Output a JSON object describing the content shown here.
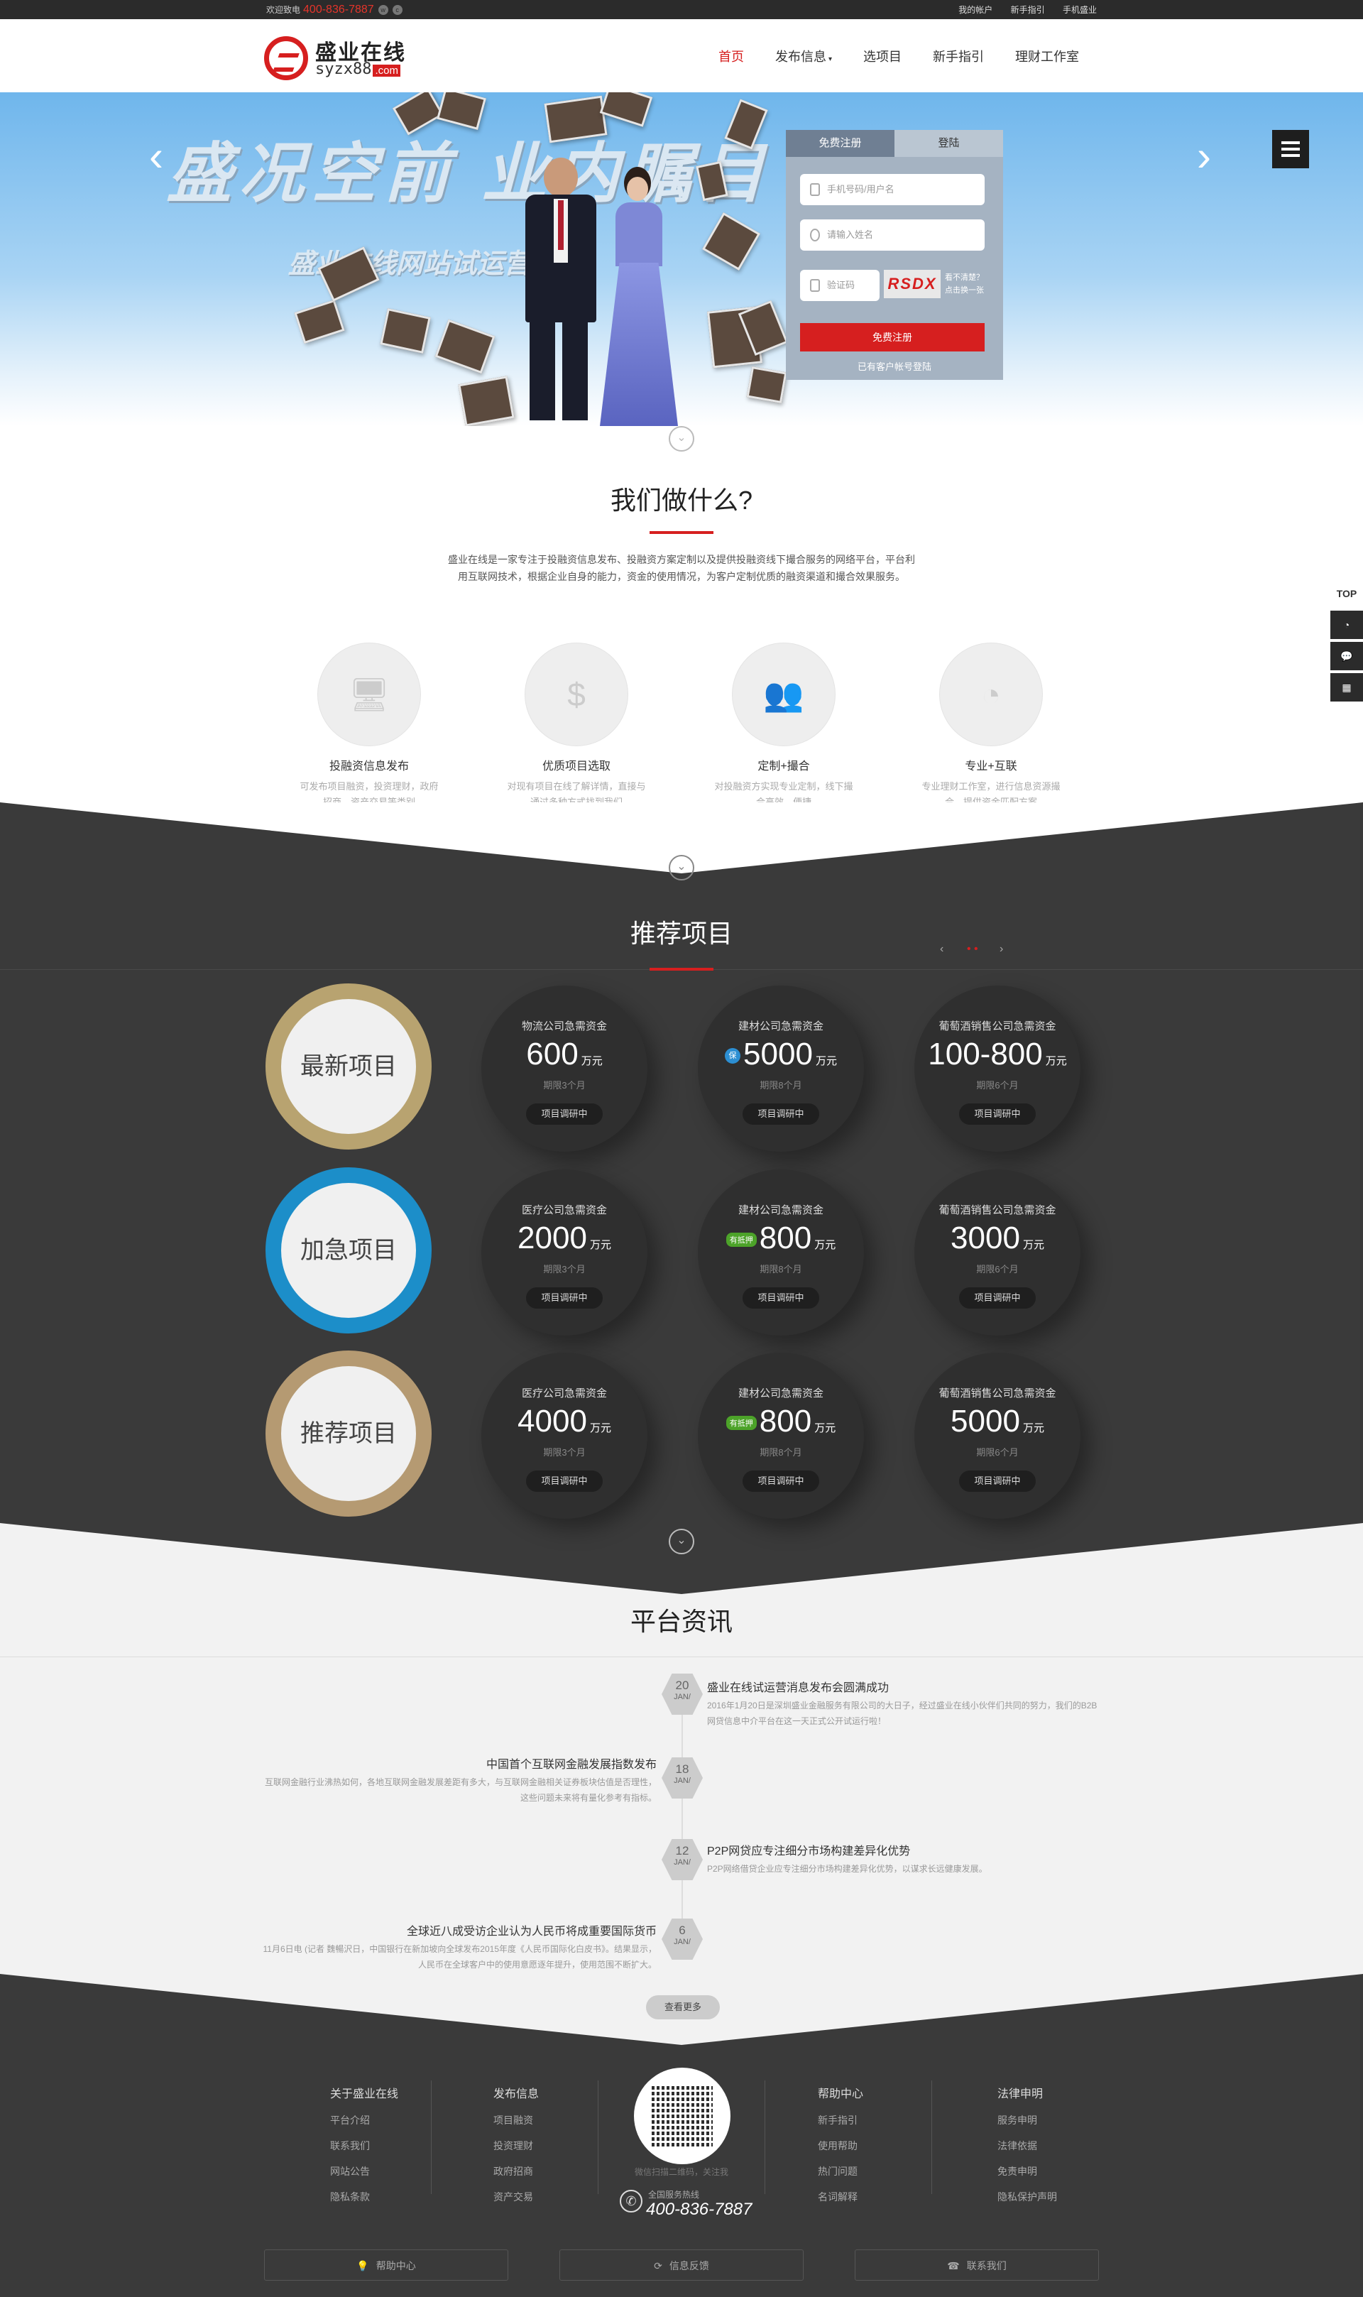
{
  "topbar": {
    "welcome": "欢迎致电",
    "phone": "400-836-7887",
    "links": [
      "我的帐户",
      "新手指引",
      "手机盛业"
    ]
  },
  "header": {
    "logo_name": "盛业在线",
    "logo_domain": "syzx88",
    "logo_tld": ".com",
    "nav": [
      {
        "label": "首页",
        "active": true
      },
      {
        "label": "发布信息",
        "dropdown": true
      },
      {
        "label": "选项目"
      },
      {
        "label": "新手指引"
      },
      {
        "label": "理财工作室"
      }
    ]
  },
  "banner": {
    "big_text": "盛况空前 业内瞩目",
    "sub_text": "盛业在线网站试运营",
    "prev_icon": "‹",
    "next_icon": "›"
  },
  "register": {
    "tab_register": "免费注册",
    "tab_login": "登陆",
    "phone_placeholder": "手机号码/用户名",
    "name_placeholder": "请输入姓名",
    "code_placeholder": "验证码",
    "captcha": "RSDX",
    "captcha_hint1": "看不清楚？",
    "captcha_hint2": "点击换一张",
    "submit": "免费注册",
    "login_link": "已有客户帐号登陆"
  },
  "whatdo": {
    "title": "我们做什么?",
    "intro": "盛业在线是一家专注于投融资信息发布、投融资方案定制以及提供投融资线下撮合服务的网络平台，平台利用互联网技术，根据企业自身的能力，资金的使用情况，为客户定制优质的融资渠道和撮合效果服务。",
    "features": [
      {
        "title": "投融资信息发布",
        "desc": "可发布项目融资，投资理财，政府招商，资产交易等类别",
        "icon": "monitor-icon"
      },
      {
        "title": "优质项目选取",
        "desc": "对现有项目在线了解详情，直接与通过多种方式找到我们",
        "icon": "suitcase-icon"
      },
      {
        "title": "定制+撮合",
        "desc": "对投融资方实现专业定制，线下撮合高效、便捷",
        "icon": "people-icon"
      },
      {
        "title": "专业+互联",
        "desc": "专业理财工作室，进行信息资源撮合，提供资金匹配方案",
        "icon": "chart-icon"
      }
    ]
  },
  "projects": {
    "title": "推荐项目",
    "rows": [
      {
        "category": "最新项目",
        "items": [
          {
            "name": "物流公司急需资金",
            "value": "600",
            "unit": "万元",
            "term": "期限3个月",
            "status": "项目调研中",
            "badge": ""
          },
          {
            "name": "建材公司急需资金",
            "value": "5000",
            "unit": "万元",
            "term": "期限8个月",
            "status": "项目调研中",
            "badge": "保"
          },
          {
            "name": "葡萄酒销售公司急需资金",
            "value": "100-800",
            "unit": "万元",
            "term": "期限6个月",
            "status": "项目调研中",
            "badge": ""
          }
        ]
      },
      {
        "category": "加急项目",
        "items": [
          {
            "name": "医疗公司急需资金",
            "value": "2000",
            "unit": "万元",
            "term": "期限3个月",
            "status": "项目调研中",
            "badge": ""
          },
          {
            "name": "建材公司急需资金",
            "value": "800",
            "unit": "万元",
            "term": "期限8个月",
            "status": "项目调研中",
            "badge": "有抵押"
          },
          {
            "name": "葡萄酒销售公司急需资金",
            "value": "3000",
            "unit": "万元",
            "term": "期限6个月",
            "status": "项目调研中",
            "badge": ""
          }
        ]
      },
      {
        "category": "推荐项目",
        "items": [
          {
            "name": "医疗公司急需资金",
            "value": "4000",
            "unit": "万元",
            "term": "期限3个月",
            "status": "项目调研中",
            "badge": ""
          },
          {
            "name": "建材公司急需资金",
            "value": "800",
            "unit": "万元",
            "term": "期限8个月",
            "status": "项目调研中",
            "badge": "有抵押"
          },
          {
            "name": "葡萄酒销售公司急需资金",
            "value": "5000",
            "unit": "万元",
            "term": "期限6个月",
            "status": "项目调研中",
            "badge": ""
          }
        ]
      }
    ]
  },
  "news": {
    "title": "平台资讯",
    "more": "查看更多",
    "items": [
      {
        "day": "20",
        "month": "JAN/",
        "title": "盛业在线试运营消息发布会圆满成功",
        "desc": "2016年1月20日是深圳盛业金融服务有限公司的大日子，经过盛业在线小伙伴们共同的努力，我们的B2B网贷信息中介平台在这一天正式公开试运行啦！",
        "side": "right"
      },
      {
        "day": "18",
        "month": "JAN/",
        "title": "中国首个互联网金融发展指数发布",
        "desc": "互联网金融行业沸热如何，各地互联网金融发展差距有多大，与互联网金融相关证券板块估值是否理性，这些问题未来将有量化参考有指标。",
        "side": "left"
      },
      {
        "day": "12",
        "month": "JAN/",
        "title": "P2P网贷应专注细分市场构建差异化优势",
        "desc": "P2P网络借贷企业应专注细分市场构建差异化优势，以谋求长远健康发展。",
        "side": "right"
      },
      {
        "day": "6",
        "month": "JAN/",
        "title": "全球近八成受访企业认为人民币将成重要国际货币",
        "desc": "11月6日电 (记者 魏暢沢日，中国银行在新加坡向全球发布2015年度《人民币国际化白皮书》。结果显示，人民币在全球客户中的使用意愿逐年提升，使用范围不断扩大。",
        "side": "left"
      }
    ]
  },
  "footer": {
    "cols": [
      {
        "head": "关于盛业在线",
        "links": [
          "平台介绍",
          "联系我们",
          "网站公告",
          "隐私条款"
        ]
      },
      {
        "head": "发布信息",
        "links": [
          "项目融资",
          "投资理财",
          "政府招商",
          "资产交易"
        ]
      },
      {
        "head": "帮助中心",
        "links": [
          "新手指引",
          "使用帮助",
          "热门问题",
          "名词解释"
        ]
      },
      {
        "head": "法律申明",
        "links": [
          "服务申明",
          "法律依据",
          "免责申明",
          "隐私保护声明"
        ]
      }
    ],
    "qr_caption": "微信扫描二维码，关注我",
    "phone_label": "全国服务热线",
    "phone": "400-836-7887",
    "buttons": [
      "帮助中心",
      "信息反馈",
      "联系我们"
    ]
  },
  "side": {
    "top": "TOP"
  }
}
